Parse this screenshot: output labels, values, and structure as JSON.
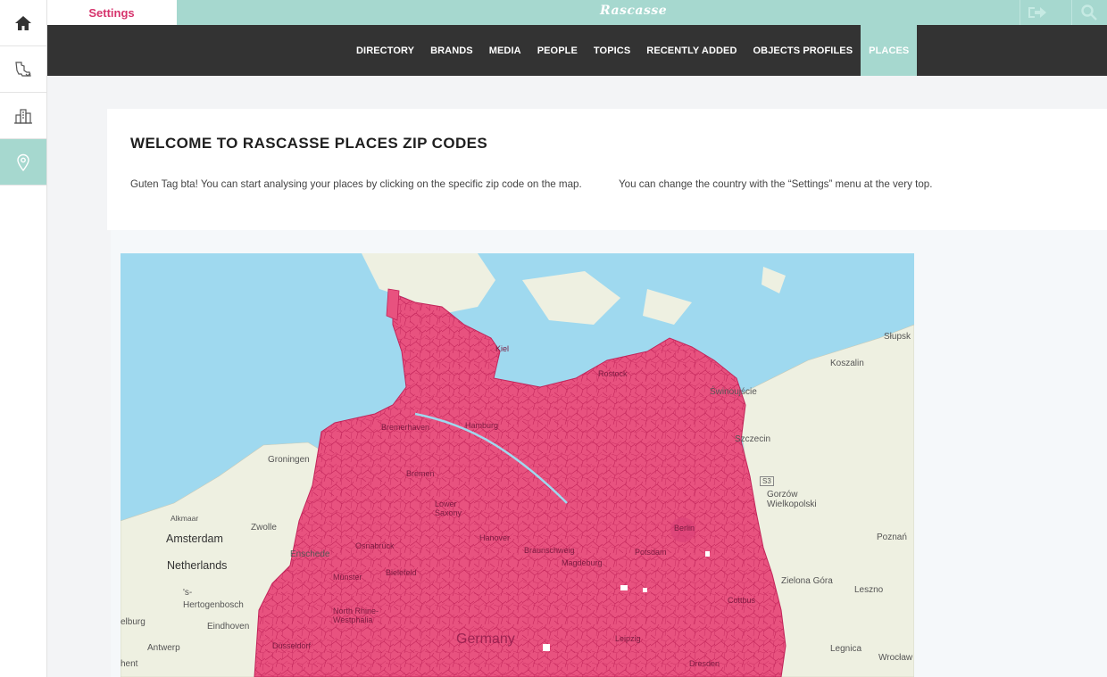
{
  "topbar": {
    "settings_label": "Settings",
    "brand": "Rascasse"
  },
  "nav": {
    "items": [
      {
        "label": "DIRECTORY"
      },
      {
        "label": "BRANDS"
      },
      {
        "label": "MEDIA"
      },
      {
        "label": "PEOPLE"
      },
      {
        "label": "TOPICS"
      },
      {
        "label": "RECENTLY ADDED"
      },
      {
        "label": "OBJECTS PROFILES"
      },
      {
        "label": "PLACES"
      }
    ],
    "active": "PLACES"
  },
  "sidebar": {
    "icons": [
      "home-icon",
      "map-region-icon",
      "buildings-icon",
      "location-pin-icon"
    ],
    "active": "location-pin-icon"
  },
  "welcome": {
    "title": "WELCOME TO RASCASSE PLACES ZIP CODES",
    "text1": "Guten Tag bta! You can start analysing your places by clicking on the specific zip code on the map.",
    "text2": "You can change the country with the “Settings” menu at the very top."
  },
  "map": {
    "labels": {
      "slupsk": "Słupsk",
      "koszalin": "Koszalin",
      "swinoujscie": "Świnoujście",
      "szczecin": "Szczecin",
      "road": "S3",
      "gorzow": "Gorzów Wielkopolski",
      "poznan": "Poznań",
      "zielona": "Zielona Góra",
      "leszno": "Leszno",
      "legnica": "Legnica",
      "wroclaw": "Wrocław",
      "groningen": "Groningen",
      "alkmaar": "Alkmaar",
      "amsterdam": "Amsterdam",
      "zwolle": "Zwolle",
      "netherlands": "Netherlands",
      "enschede": "Enschede",
      "hertogenbosch": "'s-Hertogenbosch",
      "eindhoven": "Eindhoven",
      "tilburg": "elburg",
      "antwerp": "Antwerp",
      "ghent": "hent",
      "germany": "Germany",
      "bremerhaven": "Bremerhaven",
      "hamburg": "Hamburg",
      "kiel": "Kiel",
      "rostock": "Rostock",
      "bremen": "Bremen",
      "lower_saxony": "Lower Saxony",
      "hanover": "Hanover",
      "braunschweig": "Braunschweig",
      "magdeburg": "Magdeburg",
      "osnabruck": "Osnabrück",
      "bielefeld": "Bielefeld",
      "munster": "Münster",
      "nrw": "North Rhine-Westphalia",
      "dusseldorf": "Düsseldorf",
      "berlin": "Berlin",
      "potsdam": "Potsdam",
      "cottbus": "Cottbus",
      "leipzig": "Leipzig",
      "dresden": "Dresden"
    },
    "colors": {
      "water": "#9fd9ef",
      "land": "#eef0e1",
      "zip_fill": "#e8527f",
      "zip_border": "#c2245a"
    }
  }
}
